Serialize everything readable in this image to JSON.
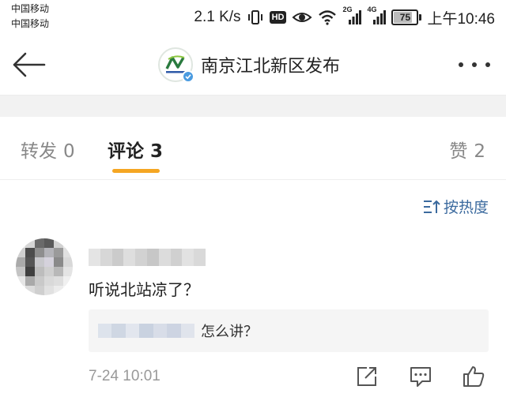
{
  "status_bar": {
    "carrier_1": "中国移动",
    "carrier_2": "中国移动",
    "speed": "2.1 K/s",
    "hd": "HD",
    "net_1": "2G",
    "net_2": "4G",
    "battery": "75",
    "time": "上午10:46",
    "icons": [
      "vibrate-icon",
      "hd-icon",
      "eye-icon",
      "wifi-icon",
      "signal-icon",
      "battery-icon"
    ]
  },
  "header": {
    "title": "南京江北新区发布",
    "back_icon": "arrow-left-icon",
    "more_icon": "more-dots-icon",
    "verified_color": "#4a9be0"
  },
  "tabs": [
    {
      "label": "转发",
      "count": "0"
    },
    {
      "label": "评论",
      "count": "3",
      "active": true
    },
    {
      "label": "赞",
      "count": "2"
    }
  ],
  "accent_color": "#f5a623",
  "sort": {
    "label": "按热度",
    "icon": "sort-icon"
  },
  "comments": [
    {
      "text": "听说北站凉了？",
      "reply": {
        "text": "怎么讲？"
      },
      "time": "7-24 10:01",
      "actions": [
        "share-icon",
        "reply-icon",
        "like-icon"
      ]
    }
  ]
}
